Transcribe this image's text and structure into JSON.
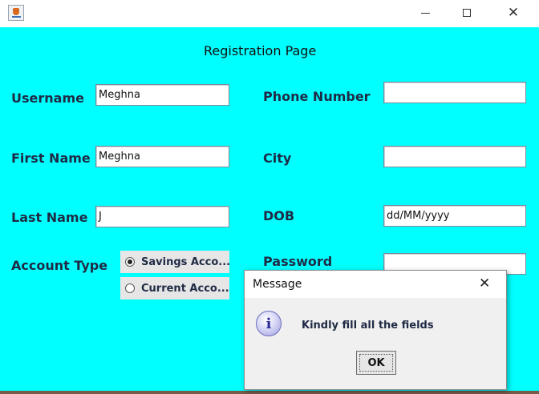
{
  "window": {
    "app_icon": "java-cup-icon",
    "controls": {
      "minimize_icon": "minimize-icon",
      "maximize_icon": "maximize-icon",
      "close_glyph": "✕"
    }
  },
  "form": {
    "title": "Registration Page",
    "background_color": "#00ffff",
    "username": {
      "label": "Username",
      "value": "Meghna"
    },
    "first_name": {
      "label": "First Name",
      "value": "Meghna"
    },
    "last_name": {
      "label": "Last Name",
      "value": "J"
    },
    "account_type": {
      "label": "Account Type",
      "options": [
        {
          "label": "Savings Acco...",
          "selected": true
        },
        {
          "label": "Current Acco...",
          "selected": false
        }
      ]
    },
    "phone_number": {
      "label": "Phone Number",
      "value": ""
    },
    "city": {
      "label": "City",
      "value": ""
    },
    "dob": {
      "label": "DOB",
      "value": "dd/MM/yyyy"
    },
    "password": {
      "label": "Password",
      "value": ""
    }
  },
  "dialog": {
    "title": "Message",
    "close_glyph": "✕",
    "icon": "info-icon",
    "icon_glyph": "i",
    "message": "Kindly fill all the fields",
    "ok_label": "OK"
  }
}
